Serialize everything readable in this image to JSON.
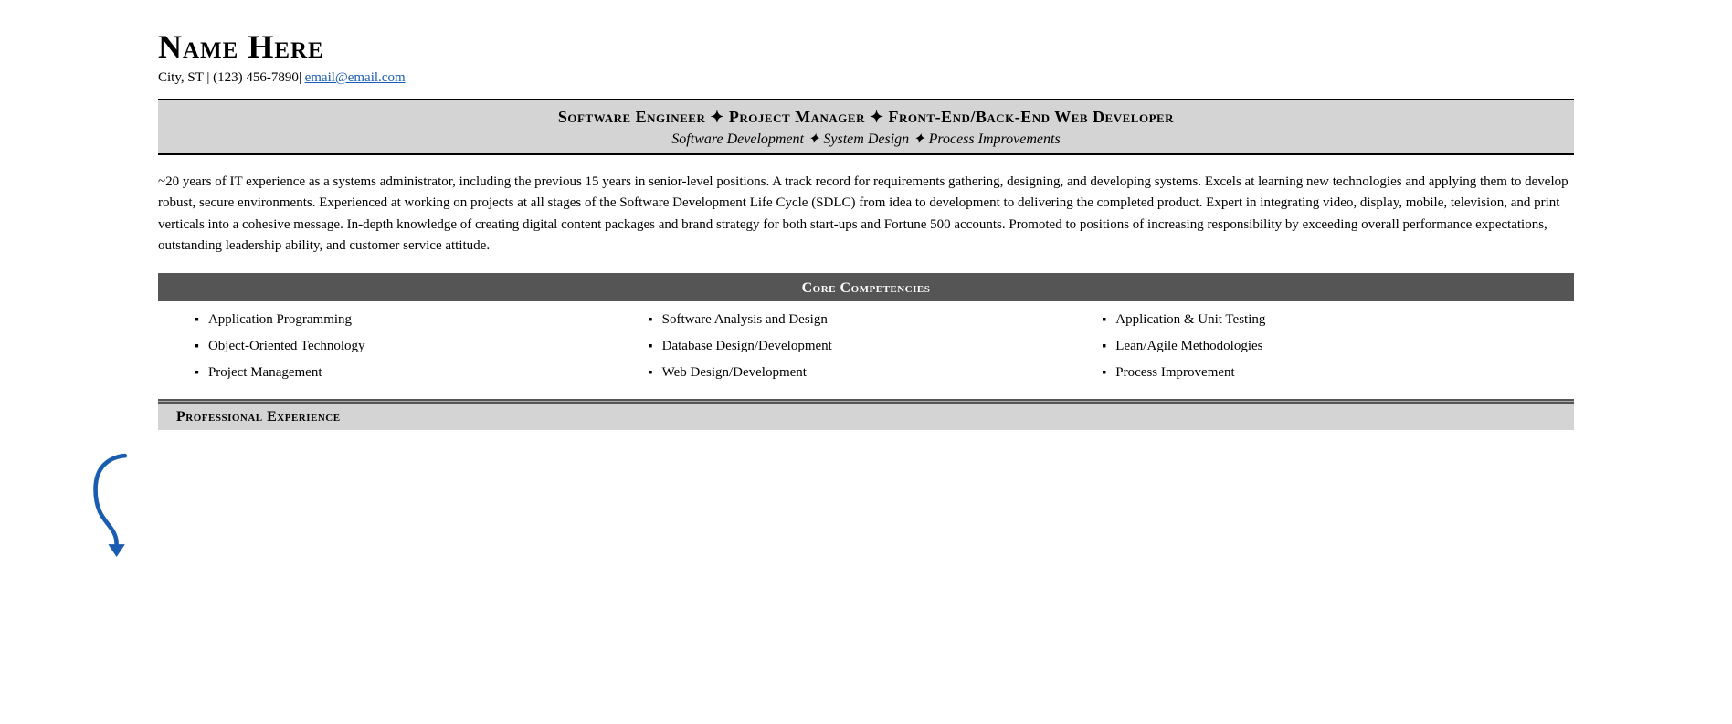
{
  "header": {
    "name": "Name Here",
    "contact": "City, ST | (123) 456-7890|",
    "email_text": "email@email.com",
    "email_href": "mailto:email@email.com"
  },
  "title_banner": {
    "main_title": "Software Engineer ✦ Project Manager ✦ Front-End/Back-End Web Developer",
    "sub_title": "Software Development ✦ System Design ✦ Process Improvements"
  },
  "summary": {
    "text": "~20 years of IT experience as a systems administrator, including the previous 15 years in senior-level positions. A track record for requirements gathering, designing, and developing systems. Excels at learning new technologies and applying them to develop robust, secure environments. Experienced at working on projects at all stages of the Software Development Life Cycle (SDLC) from idea to development to delivering the completed product. Expert in integrating video, display, mobile, television, and print verticals into a cohesive message. In-depth knowledge of creating digital content packages and brand strategy for both start-ups and Fortune 500 accounts. Promoted to positions of increasing responsibility by exceeding overall performance expectations, outstanding leadership ability, and customer service attitude."
  },
  "core_competencies": {
    "header": "Core Competencies",
    "columns": [
      [
        "Application Programming",
        "Object-Oriented Technology",
        "Project Management"
      ],
      [
        "Software Analysis and Design",
        "Database Design/Development",
        "Web Design/Development"
      ],
      [
        "Application & Unit Testing",
        "Lean/Agile Methodologies",
        "Process Improvement"
      ]
    ]
  },
  "professional_experience": {
    "header": "Professional Experience"
  }
}
